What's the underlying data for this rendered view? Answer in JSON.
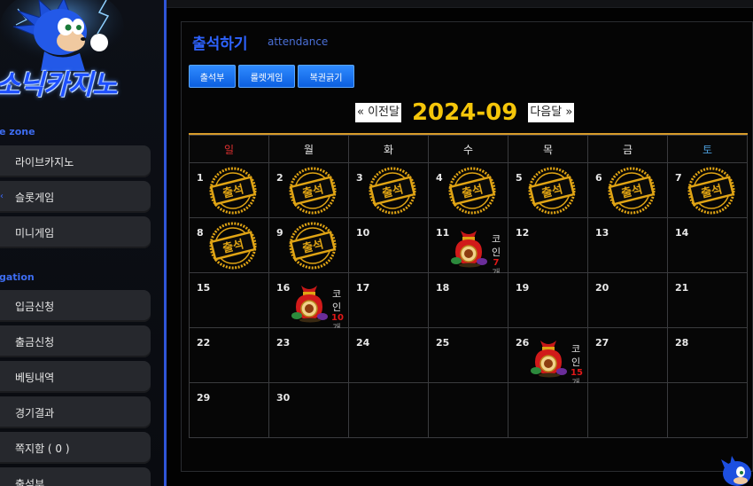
{
  "sidebar": {
    "logo_text": "소닉카지노",
    "sections": [
      {
        "title": "e zone",
        "items": [
          {
            "label": "라이브카지노"
          },
          {
            "label": "슬롯게임"
          },
          {
            "label": "미니게임"
          }
        ]
      },
      {
        "title": "gation",
        "items": [
          {
            "label": "입금신청"
          },
          {
            "label": "출금신청"
          },
          {
            "label": "베팅내역"
          },
          {
            "label": "경기결과"
          },
          {
            "label": "쪽지함 ( 0 )"
          },
          {
            "label": "출석부"
          }
        ]
      }
    ]
  },
  "panel": {
    "title": "출석하기",
    "subtitle": "attendance",
    "tabs": [
      {
        "label": "출석부"
      },
      {
        "label": "룰렛게임"
      },
      {
        "label": "복권긁기"
      }
    ],
    "nav": {
      "prev": "« 이전달",
      "month": "2024-09",
      "next": "다음달 »"
    }
  },
  "calendar": {
    "weekdays": [
      {
        "label": "일",
        "color": "#e03030"
      },
      {
        "label": "월",
        "color": "#e8e8e8"
      },
      {
        "label": "화",
        "color": "#e8e8e8"
      },
      {
        "label": "수",
        "color": "#e8e8e8"
      },
      {
        "label": "목",
        "color": "#e8e8e8"
      },
      {
        "label": "금",
        "color": "#e8e8e8"
      },
      {
        "label": "토",
        "color": "#4a9ad6"
      }
    ],
    "stamp_text": "출석",
    "coin_label": "코인",
    "coin_unit": "개",
    "weeks": [
      [
        {
          "day": "1",
          "stamp": true
        },
        {
          "day": "2",
          "stamp": true
        },
        {
          "day": "3",
          "stamp": true
        },
        {
          "day": "4",
          "stamp": true
        },
        {
          "day": "5",
          "stamp": true
        },
        {
          "day": "6",
          "stamp": true
        },
        {
          "day": "7",
          "stamp": true
        }
      ],
      [
        {
          "day": "8",
          "stamp": true
        },
        {
          "day": "9",
          "stamp": true
        },
        {
          "day": "10"
        },
        {
          "day": "11",
          "coins": "7"
        },
        {
          "day": "12"
        },
        {
          "day": "13"
        },
        {
          "day": "14"
        }
      ],
      [
        {
          "day": "15"
        },
        {
          "day": "16",
          "coins": "10"
        },
        {
          "day": "17"
        },
        {
          "day": "18"
        },
        {
          "day": "19"
        },
        {
          "day": "20"
        },
        {
          "day": "21"
        }
      ],
      [
        {
          "day": "22"
        },
        {
          "day": "23"
        },
        {
          "day": "24"
        },
        {
          "day": "25"
        },
        {
          "day": "26",
          "coins": "15"
        },
        {
          "day": "27"
        },
        {
          "day": "28"
        }
      ],
      [
        {
          "day": "29"
        },
        {
          "day": "30"
        },
        {
          "day": ""
        },
        {
          "day": ""
        },
        {
          "day": ""
        },
        {
          "day": ""
        },
        {
          "day": ""
        }
      ]
    ]
  },
  "colors": {
    "accent": "#2f63ff",
    "month": "#f5c60a",
    "stamp_gold": "#e0a414",
    "coin_red": "#e01818"
  }
}
